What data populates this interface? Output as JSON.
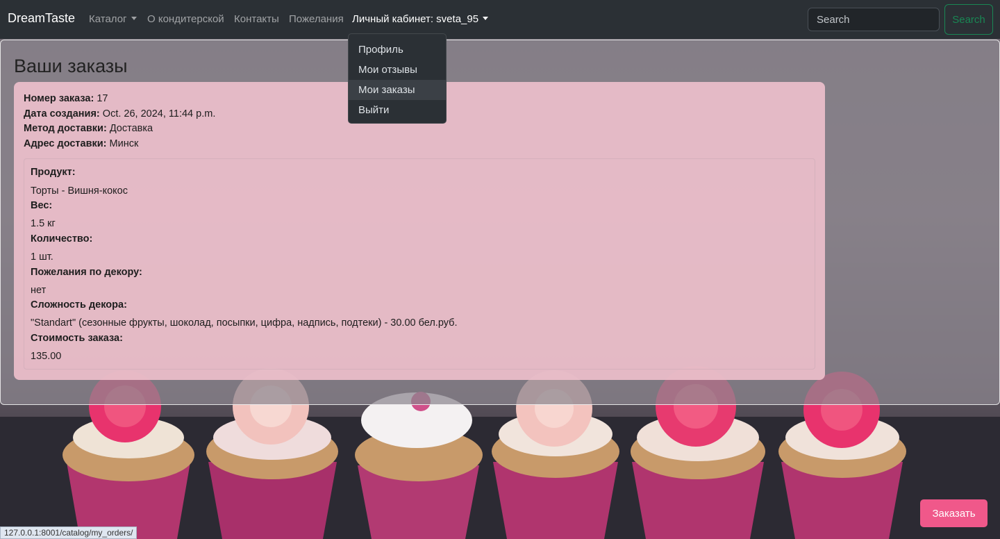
{
  "navbar": {
    "brand": "DreamTaste",
    "catalog": "Каталог",
    "about": "О кондитерской",
    "contacts": "Контакты",
    "wishes": "Пожелания",
    "account": "Личный кабинет: sveta_95",
    "search_placeholder": "Search",
    "search_button": "Search"
  },
  "dropdown": {
    "items": [
      "Профиль",
      "Мои отзывы",
      "Мои заказы",
      "Выйти"
    ]
  },
  "page": {
    "title": "Ваши заказы"
  },
  "order": {
    "number_label": "Номер заказа:",
    "number_value": "17",
    "created_label": "Дата создания:",
    "created_value": "Oct. 26, 2024, 11:44 p.m.",
    "delivery_method_label": "Метод доставки:",
    "delivery_method_value": "Доставка",
    "address_label": "Адрес доставки:",
    "address_value": "Минск",
    "item": {
      "product_label": "Продукт:",
      "product_value": "Торты - Вишня-кокос",
      "weight_label": "Вес:",
      "weight_value": "1.5 кг",
      "quantity_label": "Количество:",
      "quantity_value": "1 шт.",
      "decor_wishes_label": "Пожелания по декору:",
      "decor_wishes_value": "нет",
      "decor_complexity_label": "Сложность декора:",
      "decor_complexity_value": "\"Standart\" (сезонные фрукты, шоколад, посыпки, цифра, надпись, подтеки) - 30.00 бел.руб.",
      "cost_label": "Стоимость заказа:",
      "cost_value": "135.00"
    }
  },
  "order_button": "Заказать",
  "status_url": "127.0.0.1:8001/catalog/my_orders/",
  "colors": {
    "navbar": "#2b3035",
    "search_accent": "#198754",
    "order_button": "#f0588a",
    "card": "#ecbeca"
  }
}
